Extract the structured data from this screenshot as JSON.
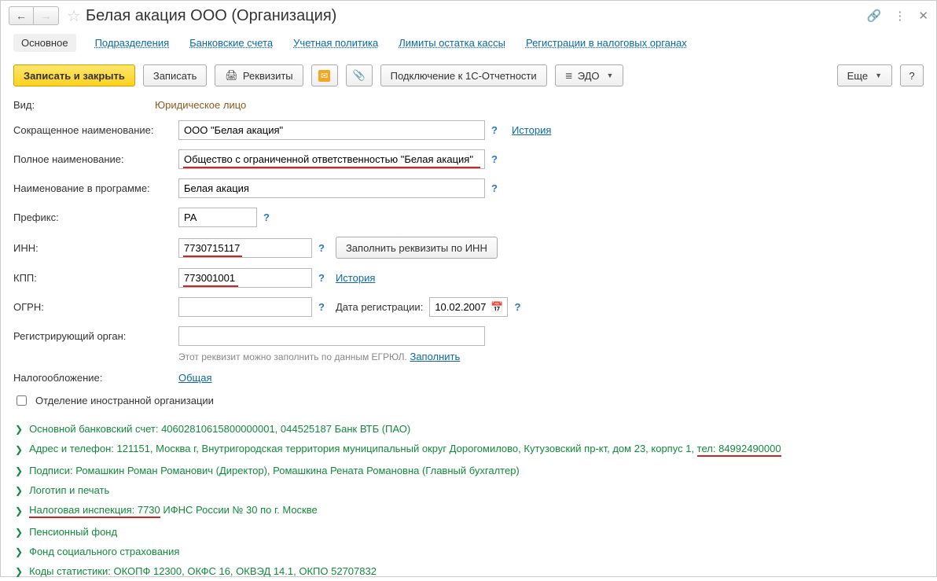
{
  "title": "Белая акация ООО (Организация)",
  "tabs": {
    "main": "Основное",
    "divisions": "Подразделения",
    "bank_accounts": "Банковские счета",
    "accounting_policy": "Учетная политика",
    "cash_limits": "Лимиты остатка кассы",
    "tax_registrations": "Регистрации в налоговых органах"
  },
  "toolbar": {
    "save_close": "Записать и закрыть",
    "save": "Записать",
    "requisites": "Реквизиты",
    "connect_1c": "Подключение к 1С-Отчетности",
    "edo": "ЭДО",
    "more": "Еще",
    "help": "?"
  },
  "form": {
    "type_label": "Вид:",
    "type_value": "Юридическое лицо",
    "short_name_label": "Сокращенное наименование:",
    "short_name_value": "ООО \"Белая акация\"",
    "history": "История",
    "full_name_label": "Полное наименование:",
    "full_name_value": "Общество с ограниченной ответственностью \"Белая акация\"",
    "prog_name_label": "Наименование в программе:",
    "prog_name_value": "Белая акация",
    "prefix_label": "Префикс:",
    "prefix_value": "РА",
    "inn_label": "ИНН:",
    "inn_value": "7730715117",
    "fill_by_inn": "Заполнить реквизиты по ИНН",
    "kpp_label": "КПП:",
    "kpp_value": "773001001",
    "ogrn_label": "ОГРН:",
    "ogrn_value": "",
    "reg_date_label": "Дата регистрации:",
    "reg_date_value": "10.02.2007",
    "reg_body_label": "Регистрирующий орган:",
    "reg_body_value": "",
    "reg_hint": "Этот реквизит можно заполнить по данным ЕГРЮЛ.",
    "fill_link": "Заполнить",
    "taxation_label": "Налогообложение:",
    "taxation_value": "Общая",
    "foreign_branch": "Отделение иностранной организации"
  },
  "sections": {
    "bank": "Основной банковский счет: 40602810615800000001, 044525187 Банк ВТБ (ПАО)",
    "address_prefix": "Адрес и телефон: 121151, Москва г, Внутригородская территория муниципальный округ Дорогомилово, Кутузовский пр-кт, дом 23, корпус 1, ",
    "address_phone": "тел: 84992490000",
    "signatures": "Подписи: Ромашкин Роман Романович (Директор), Ромашкина Рената Романовна (Главный бухгалтер)",
    "logo": "Логотип и печать",
    "tax_office_prefix": "Налоговая инспекция: 7730",
    "tax_office_rest": " ИФНС России № 30 по г. Москве",
    "pension": "Пенсионный фонд",
    "social": "Фонд социального страхования",
    "stats": "Коды статистики: ОКОПФ 12300, ОКФС 16, ОКВЭД 14.1, ОКПО 52707832"
  }
}
